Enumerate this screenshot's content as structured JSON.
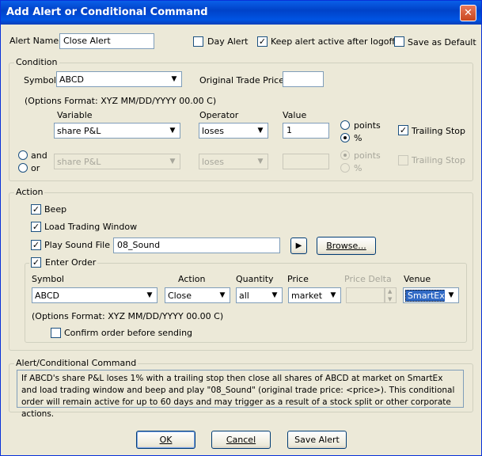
{
  "title": "Add Alert or Conditional Command",
  "alert_name": {
    "label": "Alert Name:",
    "value": "Close Alert"
  },
  "options": {
    "day_alert": {
      "label": "Day Alert",
      "checked": false
    },
    "keep_active": {
      "label": "Keep alert active after logoff",
      "checked": true
    },
    "save_default": {
      "label": "Save as Default",
      "checked": false
    }
  },
  "condition": {
    "group_label": "Condition",
    "symbol_label": "Symbol",
    "symbol_value": "ABCD",
    "orig_price_label": "Original Trade Price",
    "orig_price_value": "",
    "format_hint": "(Options Format: XYZ MM/DD/YYYY 00.00 C)",
    "variable_label": "Variable",
    "operator_label": "Operator",
    "value_label": "Value",
    "row1": {
      "variable": "share P&L",
      "operator": "loses",
      "value": "1",
      "points_label": "points",
      "percent_label": "%",
      "trailing_label": "Trailing Stop"
    },
    "row2": {
      "and_label": "and",
      "or_label": "or",
      "variable": "share P&L",
      "operator": "loses",
      "value": "",
      "points_label": "points",
      "percent_label": "%",
      "trailing_label": "Trailing Stop"
    }
  },
  "action": {
    "group_label": "Action",
    "beep_label": "Beep",
    "load_window_label": "Load Trading Window",
    "play_sound_label": "Play Sound File",
    "sound_file": "08_Sound",
    "play_icon": "play-triangle",
    "browse_label": "Browse...",
    "enter_order_label": "Enter Order",
    "order": {
      "symbol_label": "Symbol",
      "symbol": "ABCD",
      "action_label": "Action",
      "action": "Close",
      "quantity_label": "Quantity",
      "quantity": "all",
      "price_label": "Price",
      "price": "market",
      "price_delta_label": "Price Delta",
      "price_delta": "",
      "venue_label": "Venue",
      "venue": "SmartEx"
    },
    "format_hint": "(Options Format: XYZ MM/DD/YYYY 00.00 C)",
    "confirm_label": "Confirm order before sending"
  },
  "summary": {
    "group_label": "Alert/Conditional Command",
    "text": "If ABCD's share P&L loses 1% with a trailing stop then close all shares of ABCD at market on SmartEx and load trading window and beep and play \"08_Sound\" (original trade price: <price>). This conditional order will remain active for up to 60 days and may trigger as a result of a stock split or other corporate actions."
  },
  "buttons": {
    "ok": "OK",
    "cancel": "Cancel",
    "save_alert": "Save Alert"
  },
  "colors": {
    "titlebar": "#0054e3",
    "selection": "#316ac5"
  }
}
